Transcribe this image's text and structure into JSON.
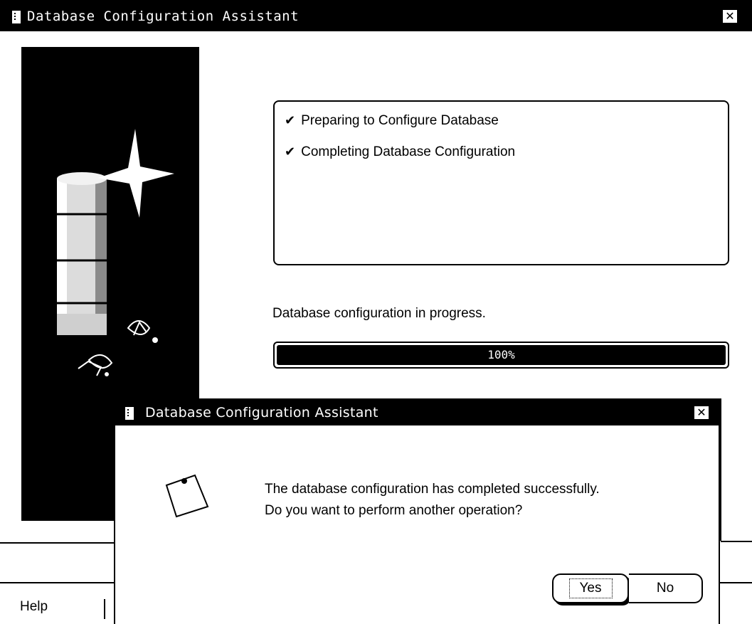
{
  "window": {
    "title": "Database Configuration Assistant",
    "close_icon": "close-icon"
  },
  "steps": [
    {
      "check": "✔",
      "label": "Preparing to Configure Database"
    },
    {
      "check": "✔",
      "label": "Completing Database Configuration"
    }
  ],
  "progress": {
    "label": "Database configuration in progress.",
    "text": "100%",
    "value": 1.0
  },
  "footer": {
    "help_label": "Help"
  },
  "dialog": {
    "title": "Database Configuration Assistant",
    "message_line1": "The database configuration has completed successfully.",
    "message_line2": "Do you want to perform another operation?",
    "yes_label": "Yes",
    "no_label": "No"
  },
  "colors": {
    "titlebar": "#000000",
    "background": "#ffffff",
    "progress_fill": "#000000"
  }
}
